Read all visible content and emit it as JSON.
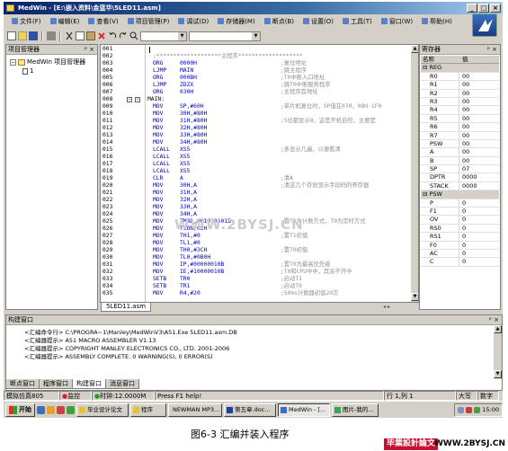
{
  "window": {
    "title": "MedWin - [E:\\嵌入资料\\金蓝华\\5LED11.asm]",
    "controls": [
      "_",
      "□",
      "×"
    ]
  },
  "menu": [
    "文件(F)",
    "编辑(E)",
    "查看(V)",
    "项目管理(P)",
    "调试(D)",
    "存储器(M)",
    "断点(B)",
    "设置(O)",
    "工具(T)",
    "窗口(W)",
    "帮助(H)"
  ],
  "project_panel": {
    "title": "项目管理器",
    "root": "MedWin 项目管理器",
    "child": "1"
  },
  "editor": {
    "tab": "5LED11.asm",
    "lines": [
      {
        "n": "001",
        "label": "",
        "op": "",
        "arg": "",
        "cmt": ""
      },
      {
        "n": "002",
        "label": "",
        "op": "",
        "arg": "",
        "cmt": "",
        "hdr": ";*******************主程序*******************"
      },
      {
        "n": "003",
        "label": "",
        "op": "ORG",
        "arg": "0000H",
        "cmt": ";复位地址"
      },
      {
        "n": "004",
        "label": "",
        "op": "LJMP",
        "arg": "MAIN",
        "cmt": ";跳主程序"
      },
      {
        "n": "005",
        "label": "",
        "op": "ORG",
        "arg": "000BH",
        "cmt": ";T0中断入口地址"
      },
      {
        "n": "006",
        "label": "",
        "op": "LJMP",
        "arg": "ZDZX",
        "cmt": ";跳T0中断服务程序"
      },
      {
        "n": "007",
        "label": "",
        "op": "ORG",
        "arg": "030H",
        "cmt": ";主程序首地址"
      },
      {
        "n": "008",
        "label": "MAIN:",
        "op": "",
        "arg": "",
        "cmt": ""
      },
      {
        "n": "009",
        "label": "",
        "op": "MOV",
        "arg": "SP,#60H",
        "cmt": ";单片机复位时，SP值在07H，08H-1FH"
      },
      {
        "n": "010",
        "label": "",
        "op": "MOV",
        "arg": "30H,#80H",
        "cmt": ""
      },
      {
        "n": "011",
        "label": "",
        "op": "MOV",
        "arg": "31H,#80H",
        "cmt": ";5位都显示8，这是开机自检，主要是"
      },
      {
        "n": "012",
        "label": "",
        "op": "MOV",
        "arg": "32H,#80H",
        "cmt": ""
      },
      {
        "n": "013",
        "label": "",
        "op": "MOV",
        "arg": "33H,#80H",
        "cmt": ""
      },
      {
        "n": "014",
        "label": "",
        "op": "MOV",
        "arg": "34H,#80H",
        "cmt": ""
      },
      {
        "n": "015",
        "label": "",
        "op": "LCALL",
        "arg": "XS5",
        "cmt": ";多显示几遍，以便看清"
      },
      {
        "n": "016",
        "label": "",
        "op": "LCALL",
        "arg": "XS5",
        "cmt": ""
      },
      {
        "n": "017",
        "label": "",
        "op": "LCALL",
        "arg": "XS5",
        "cmt": ""
      },
      {
        "n": "018",
        "label": "",
        "op": "LCALL",
        "arg": "XS5",
        "cmt": ""
      },
      {
        "n": "019",
        "label": "",
        "op": "CLR",
        "arg": "A",
        "cmt": ";清A"
      },
      {
        "n": "020",
        "label": "",
        "op": "MOV",
        "arg": "30H,A",
        "cmt": ";清这几个存放显示字段码的寄存器"
      },
      {
        "n": "021",
        "label": "",
        "op": "MOV",
        "arg": "31H,A",
        "cmt": ""
      },
      {
        "n": "022",
        "label": "",
        "op": "MOV",
        "arg": "32H,A",
        "cmt": ""
      },
      {
        "n": "023",
        "label": "",
        "op": "MOV",
        "arg": "33H,A",
        "cmt": ""
      },
      {
        "n": "024",
        "label": "",
        "op": "MOV",
        "arg": "34H,A",
        "cmt": ""
      },
      {
        "n": "025",
        "label": "",
        "op": "MOV",
        "arg": "TMOD,#01010001B",
        "cmt": ";置T1为计数方式，T0为定时方式"
      },
      {
        "n": "026",
        "label": "",
        "op": "MOV",
        "arg": "TCON,02H",
        "cmt": ""
      },
      {
        "n": "027",
        "label": "",
        "op": "MOV",
        "arg": "TH1,#0",
        "cmt": ";置T1初值"
      },
      {
        "n": "028",
        "label": "",
        "op": "MOV",
        "arg": "TL1,#0",
        "cmt": ""
      },
      {
        "n": "029",
        "label": "",
        "op": "MOV",
        "arg": "TH0,#3CH",
        "cmt": ";置T0初值"
      },
      {
        "n": "030",
        "label": "",
        "op": "MOV",
        "arg": "TL0,#0B0H",
        "cmt": ""
      },
      {
        "n": "031",
        "label": "",
        "op": "MOV",
        "arg": "IP,#00000010B",
        "cmt": ";置T0为最高优先级"
      },
      {
        "n": "032",
        "label": "",
        "op": "MOV",
        "arg": "IE,#10000010B",
        "cmt": ";T0和CPU中中，其余不开中"
      },
      {
        "n": "033",
        "label": "",
        "op": "SETB",
        "arg": "TR0",
        "cmt": ";启动T1"
      },
      {
        "n": "034",
        "label": "",
        "op": "SETB",
        "arg": "TR1",
        "cmt": ";启动T0"
      },
      {
        "n": "035",
        "label": "",
        "op": "MOV",
        "arg": "R4,#20",
        "cmt": ";50ms计数器初值20次"
      }
    ]
  },
  "watermark": "WWW.2BYSJ.CN",
  "registers": {
    "title": "寄存器",
    "col_name": "名称",
    "col_value": "值",
    "groups": [
      {
        "name": "REG",
        "rows": [
          {
            "name": "R0",
            "value": "00"
          },
          {
            "name": "R1",
            "value": "00"
          },
          {
            "name": "R2",
            "value": "00"
          },
          {
            "name": "R3",
            "value": "00"
          },
          {
            "name": "R4",
            "value": "00"
          },
          {
            "name": "R5",
            "value": "00"
          },
          {
            "name": "R6",
            "value": "00"
          },
          {
            "name": "R7",
            "value": "00"
          },
          {
            "name": "PSW",
            "value": "00"
          },
          {
            "name": "A",
            "value": "00"
          },
          {
            "name": "B",
            "value": "00"
          },
          {
            "name": "SP",
            "value": "07"
          },
          {
            "name": "DPTR",
            "value": "0000"
          },
          {
            "name": "STACK",
            "value": "0000"
          }
        ]
      },
      {
        "name": "PSW",
        "rows": [
          {
            "name": "P",
            "value": "0"
          },
          {
            "name": "F1",
            "value": "0"
          },
          {
            "name": "OV",
            "value": "0"
          },
          {
            "name": "RS0",
            "value": "0"
          },
          {
            "name": "RS1",
            "value": "0"
          },
          {
            "name": "F0",
            "value": "0"
          },
          {
            "name": "AC",
            "value": "0"
          },
          {
            "name": "C",
            "value": "0"
          }
        ]
      }
    ]
  },
  "build": {
    "title": "构建窗口",
    "lines": [
      "<汇编命令行> C:\\PROGRA~1\\Manley\\MedWinV3\\A51.Exe 5LED11.asm.DB",
      "<汇编器提示> A51 MACRO ASSEMBLER V1.13",
      "<汇编器提示> COPYRIGHT MANLEY ELECTRONICS CO., LTD. 2001-2006",
      "<汇编器提示> ASSEMBLY COMPLETE.  0 WARNING(S),  0 ERROR(S)"
    ],
    "tabs": [
      "断点窗口",
      "程序窗口",
      "构建窗口",
      "消息窗口"
    ]
  },
  "status": {
    "mode": "模拟仿真805",
    "monitor": "监控",
    "clock": "时钟:12.0000M",
    "help": "Press F1 help!",
    "pos": "行 1,列 1",
    "caps": "大写",
    "num": "数字"
  },
  "taskbar": {
    "start": "开始",
    "tasks": [
      "毕业设计论文",
      "程序",
      "NEWMAN MP3...",
      "第五章.doc...",
      "MedWin - [...",
      "图片-我的..."
    ],
    "clock": "15:00"
  },
  "caption": "图6-3  汇编并装入程序",
  "brand": {
    "name": "毕業設計論文",
    "url": "WWW.2BYSJ.CN"
  }
}
